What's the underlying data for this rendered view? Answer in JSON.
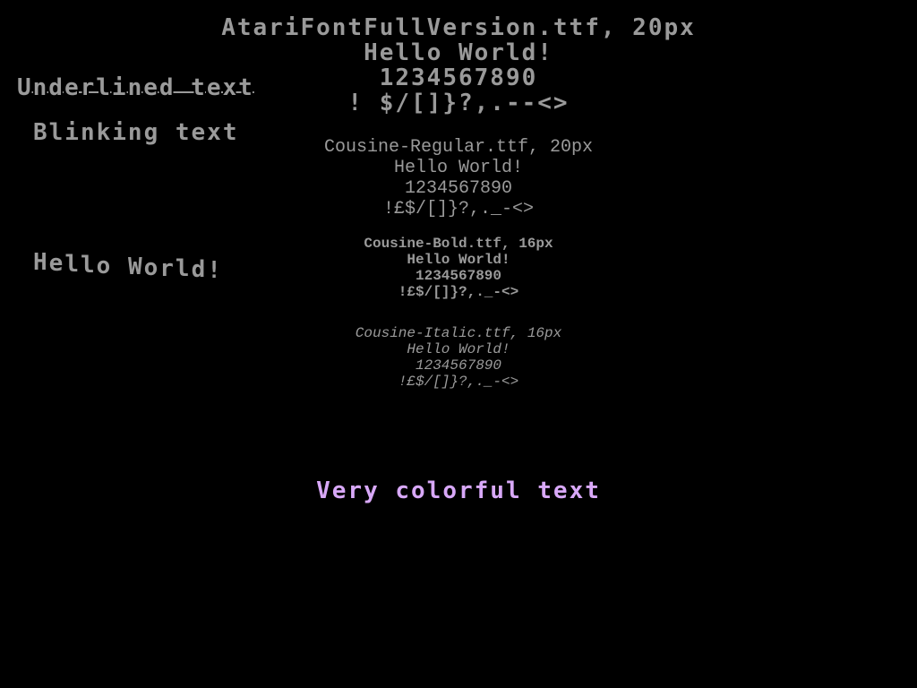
{
  "atari_block": {
    "title": "AtariFontFullVersion.ttf, 20px",
    "hello": "Hello World!",
    "digits": "1234567890",
    "symbols": "! $/[]}?,.--<>"
  },
  "left_column": {
    "underlined": "Underlined text",
    "blinking": "Blinking text",
    "wavy": "Hello World!"
  },
  "cousine_regular": {
    "title": "Cousine-Regular.ttf, 20px",
    "hello": "Hello World!",
    "digits": "1234567890",
    "symbols": "!£$/[]}?,._-<>"
  },
  "cousine_bold": {
    "title": "Cousine-Bold.ttf, 16px",
    "hello": "Hello World!",
    "digits": "1234567890",
    "symbols": "!£$/[]}?,._-<>"
  },
  "cousine_italic": {
    "title": "Cousine-Italic.ttf, 16px",
    "hello": "Hello World!",
    "digits": "1234567890",
    "symbols": "!£$/[]}?,._-<>"
  },
  "colorful": {
    "text": "Very colorful text",
    "color": "#d8a8f8"
  },
  "colors": {
    "background": "#000000",
    "text_gray": "#9a9a9a"
  }
}
